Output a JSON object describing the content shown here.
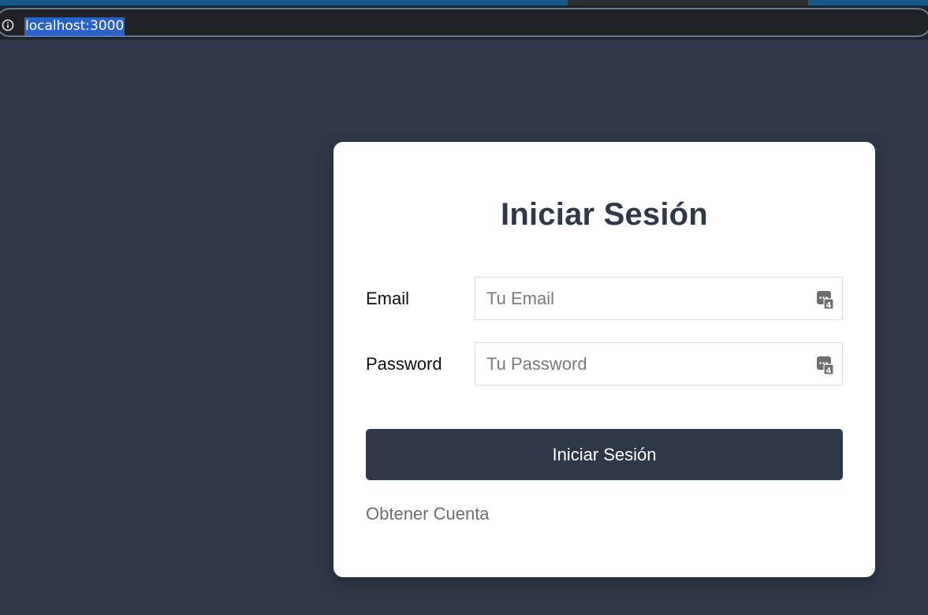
{
  "browser": {
    "url": "localhost:3000"
  },
  "login": {
    "title": "Iniciar Sesión",
    "email_label": "Email",
    "email_placeholder": "Tu Email",
    "password_label": "Password",
    "password_placeholder": "Tu Password",
    "submit_label": "Iniciar Sesión",
    "signup_link": "Obtener Cuenta"
  },
  "colors": {
    "page_background": "#2f3848",
    "button_background": "#2f3848",
    "title_color": "#2f3848",
    "url_highlight": "#2a62c9"
  },
  "icons": {
    "address_bar": "info-icon",
    "field_autofill": "password-manager-icon"
  }
}
